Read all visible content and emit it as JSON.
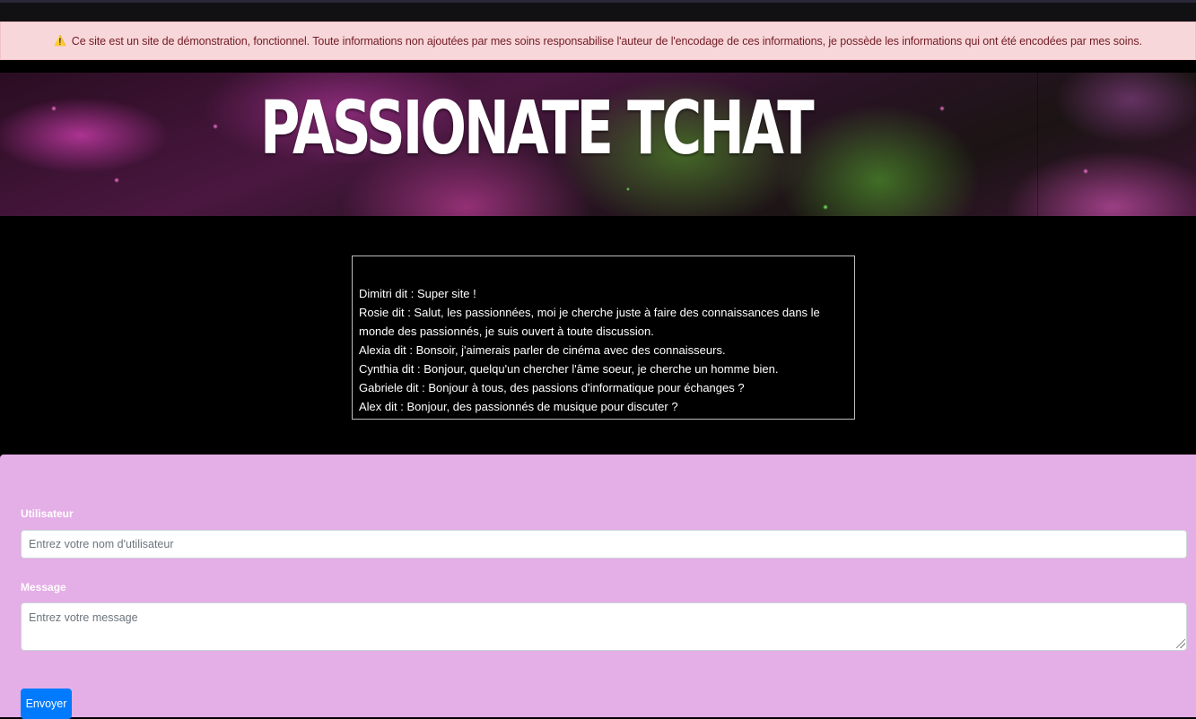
{
  "alert": {
    "icon": "warning-icon",
    "icon_glyph": "⚠️",
    "text": "Ce site est un site de démonstration, fonctionnel. Toute informations non ajoutées par mes soins responsabilise l'auteur de l'encodage de ces informations, je possède les informations qui ont été encodées par mes soins."
  },
  "banner": {
    "title": "PASSIONATE TCHAT"
  },
  "chat": {
    "messages": [
      "Dimitri dit : Super site !",
      "Rosie dit : Salut, les passionnées, moi je cherche juste à faire des connaissances dans le monde des passionnés, je suis ouvert à toute discussion.",
      "Alexia dit : Bonsoir, j'aimerais parler de cinéma avec des connaisseurs.",
      "Cynthia dit : Bonjour, quelqu'un chercher l'âme soeur, je cherche un homme bien.",
      "Gabriele dit : Bonjour à tous, des passions d'informatique pour échanges ?",
      "Alex dit : Bonjour, des passionnés de musique pour discuter ?"
    ]
  },
  "form": {
    "username_label": "Utilisateur",
    "username_placeholder": "Entrez votre nom d'utilisateur",
    "username_value": "",
    "message_label": "Message",
    "message_placeholder": "Entrez votre message",
    "message_value": "",
    "submit_label": "Envoyer"
  },
  "colors": {
    "alert_bg": "#f8d7da",
    "alert_text": "#721c24",
    "form_bg": "#e4aee6",
    "button_bg": "#007bff"
  }
}
